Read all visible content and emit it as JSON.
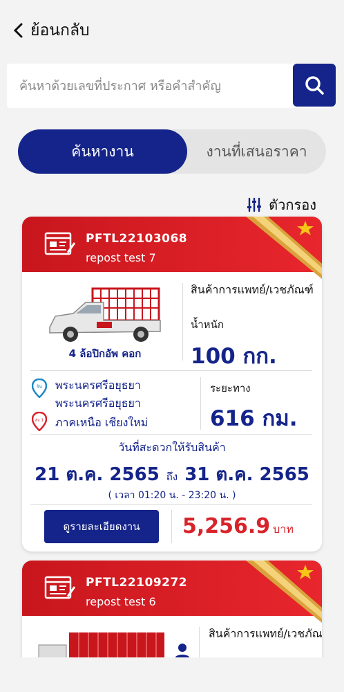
{
  "header": {
    "back_label": "ย้อนกลับ"
  },
  "search": {
    "placeholder": "ค้นหาด้วยเลขที่ประกาศ หรือคำสำคัญ",
    "value": ""
  },
  "tabs": [
    {
      "label": "ค้นหางาน",
      "active": true
    },
    {
      "label": "งานที่เสนอราคา",
      "active": false
    }
  ],
  "filter": {
    "label": "ตัวกรอง"
  },
  "colors": {
    "primary": "#14248a",
    "accent_red": "#d8232a",
    "header_red": "#e02028",
    "ribbon_gold": "#e8b84a"
  },
  "jobs": [
    {
      "id": "PFTL22103068",
      "title": "repost test 7",
      "vehicle": "4 ล้อปิกอัพ คอก",
      "goods_type": "สินค้าการแพทย์/เวชภัณฑ์",
      "weight_label": "น้ำหนัก",
      "weight_value": "100 กก.",
      "pickup": "พระนครศรีอยุธยา",
      "pickup_tag": "รับ",
      "stop": "พระนครศรีอยุธยา",
      "dropoff": "ภาคเหนือ เชียงใหม่",
      "dropoff_tag": "ส่ง 1",
      "distance_label": "ระยะทาง",
      "distance_value": "616 กม.",
      "date_title": "วันที่สะดวกให้รับสินค้า",
      "date_from": "21 ต.ค. 2565",
      "date_sep": "ถึง",
      "date_to": "31 ต.ค. 2565",
      "time_range": "( เวลา 01:20 น. - 23:20 น. )",
      "detail_button": "ดูรายละเอียดงาน",
      "price": "5,256.9",
      "price_unit": "บาท"
    },
    {
      "id": "PFTL22109272",
      "title": "repost test 6",
      "goods_type": "สินค้าการแพทย์/เวชภัณฑ์"
    }
  ]
}
